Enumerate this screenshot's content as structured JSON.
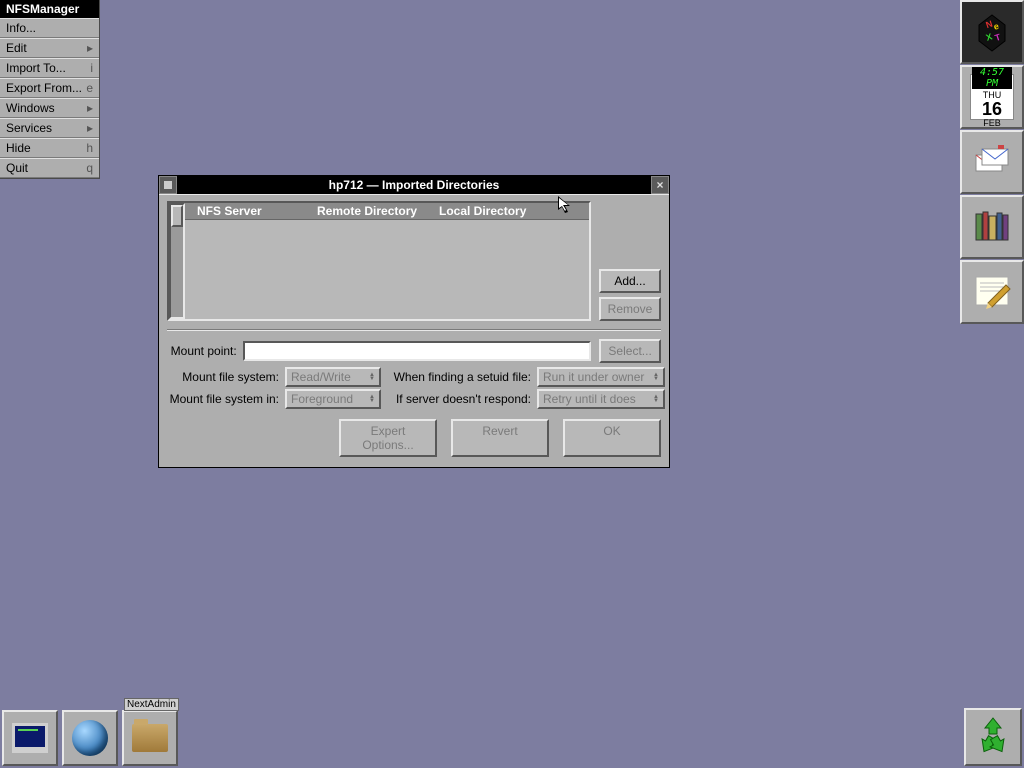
{
  "menu": {
    "title": "NFSManager",
    "items": [
      {
        "label": "Info...",
        "shortcut": ""
      },
      {
        "label": "Edit",
        "shortcut": "▸"
      },
      {
        "label": "Import To...",
        "shortcut": "i"
      },
      {
        "label": "Export From...",
        "shortcut": "e"
      },
      {
        "label": "Windows",
        "shortcut": "▸"
      },
      {
        "label": "Services",
        "shortcut": "▸"
      },
      {
        "label": "Hide",
        "shortcut": "h"
      },
      {
        "label": "Quit",
        "shortcut": "q"
      }
    ]
  },
  "window": {
    "title": "hp712  —  Imported Directories",
    "columns": {
      "c1": "NFS Server",
      "c2": "Remote Directory",
      "c3": "Local Directory"
    },
    "buttons": {
      "add": "Add...",
      "remove": "Remove",
      "select": "Select...",
      "expert": "Expert Options...",
      "revert": "Revert",
      "ok": "OK"
    },
    "labels": {
      "mountpoint": "Mount point:",
      "mountfs": "Mount file system:",
      "mountfsin": "Mount file system in:",
      "setuid": "When finding a setuid file:",
      "norespond": "If server doesn't respond:"
    },
    "values": {
      "mountpoint": "",
      "mountfs": "Read/Write",
      "mountfsin": "Foreground",
      "setuid": "Run it under owner",
      "norespond": "Retry until it does"
    }
  },
  "dock": {
    "clock": {
      "time": "4:57 PM",
      "dow": "THU",
      "day": "16",
      "mon": "FEB"
    }
  },
  "shelf": {
    "tile3_label": "NextAdmin"
  }
}
